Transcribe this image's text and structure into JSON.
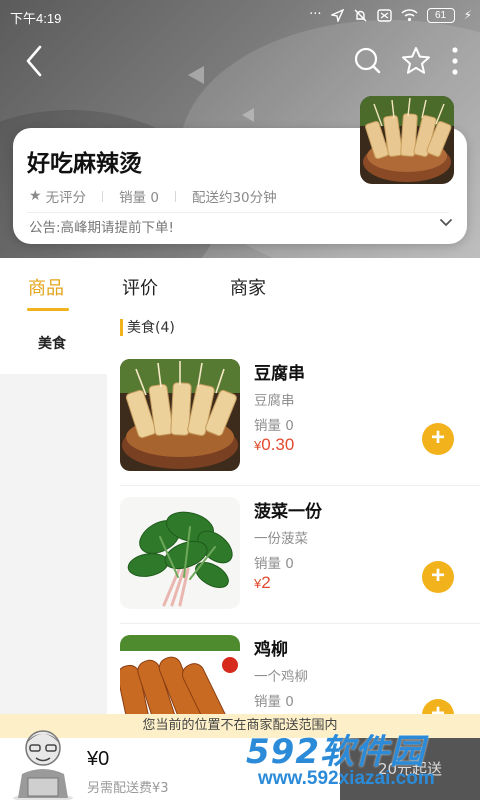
{
  "status_bar": {
    "time": "下午4:19",
    "battery": "61"
  },
  "store": {
    "name": "好吃麻辣烫",
    "rating": "无评分",
    "sales": "销量 0",
    "delivery": "配送约30分钟",
    "notice": "公告:高峰期请提前下单!"
  },
  "tabs": [
    {
      "label": "商品",
      "active": true
    },
    {
      "label": "评价",
      "active": false
    },
    {
      "label": "商家",
      "active": false
    }
  ],
  "categories": [
    {
      "label": "美食",
      "active": true
    }
  ],
  "section": {
    "title": "美食(4)"
  },
  "products": [
    {
      "name": "豆腐串",
      "desc": "豆腐串",
      "sales": "销量 0",
      "currency": "¥",
      "price": "0.30"
    },
    {
      "name": "菠菜一份",
      "desc": "一份菠菜",
      "sales": "销量 0",
      "currency": "¥",
      "price": "2"
    },
    {
      "name": "鸡柳",
      "desc": "一个鸡柳",
      "sales": "销量 0",
      "currency": "",
      "price": ""
    }
  ],
  "bottom": {
    "notice": "您当前的位置不在商家配送范围内",
    "amount": "¥0",
    "fee": "另需配送费¥3",
    "checkout": "20元起送"
  },
  "watermark": {
    "big": "592软件园",
    "small": "www.592xiazai.com"
  },
  "colors": {
    "accent": "#f2b21c",
    "price": "#e34b2f"
  }
}
